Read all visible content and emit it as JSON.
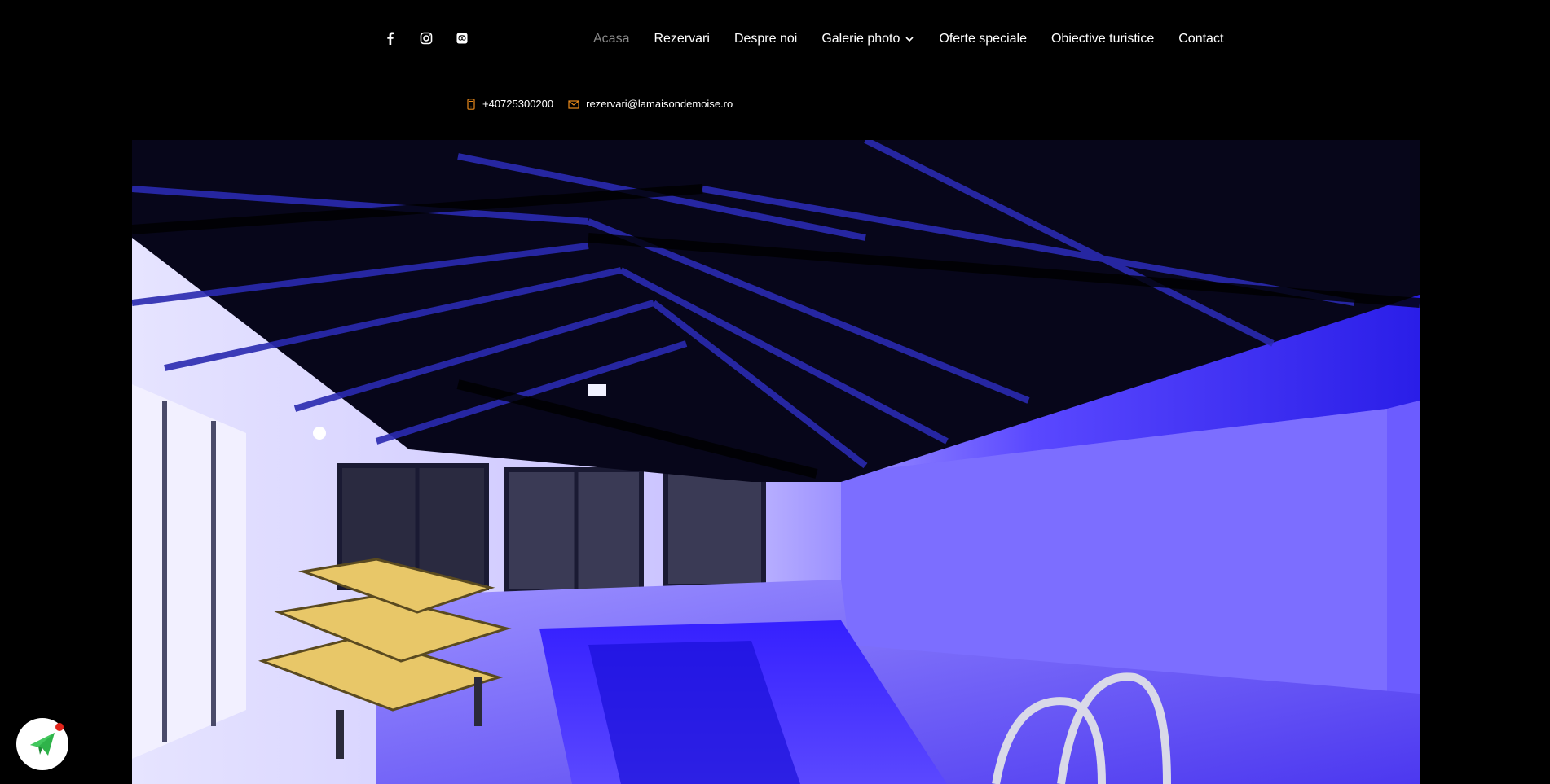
{
  "social": {
    "items": [
      {
        "icon": "facebook-icon"
      },
      {
        "icon": "instagram-icon"
      },
      {
        "icon": "tripadvisor-icon"
      }
    ]
  },
  "nav": {
    "items": [
      {
        "label": "Acasa",
        "active": true
      },
      {
        "label": "Rezervari"
      },
      {
        "label": "Despre noi"
      },
      {
        "label": "Galerie photo",
        "has_dropdown": true
      },
      {
        "label": "Oferte speciale"
      },
      {
        "label": "Obiective turistice"
      },
      {
        "label": "Contact"
      }
    ]
  },
  "contact": {
    "phone": "+40725300200",
    "email": "rezervari@lamaisondemoise.ro",
    "icon_color": "#e8891b"
  },
  "hero": {
    "description_icon": "pool-hero-image"
  },
  "widget": {
    "icon": "send-icon",
    "accent": "#2fb34a",
    "badge_color": "#e2231a"
  }
}
